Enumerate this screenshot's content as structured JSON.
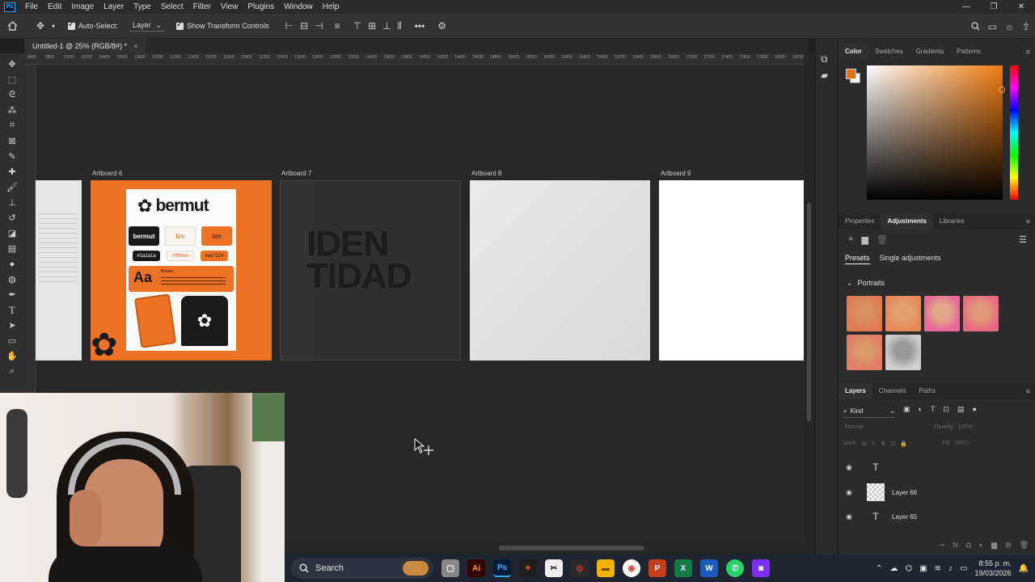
{
  "menubar": {
    "items": [
      "File",
      "Edit",
      "Image",
      "Layer",
      "Type",
      "Select",
      "Filter",
      "View",
      "Plugins",
      "Window",
      "Help"
    ],
    "logo_text": "Ps"
  },
  "options": {
    "auto_select_label": "Auto-Select:",
    "auto_select_value": "Layer",
    "show_transform_label": "Show Transform Controls"
  },
  "document": {
    "tab_title": "Untitled-1 @ 25% (RGB/8#) *",
    "close": "×"
  },
  "ruler": {
    "labels": [
      "8600",
      "8800",
      "10000",
      "10200",
      "10400",
      "10600",
      "10800",
      "11000",
      "11200",
      "11400",
      "11600",
      "11800",
      "12000",
      "12200",
      "12400",
      "12600",
      "12800",
      "13000",
      "13200",
      "13400",
      "13600",
      "13800",
      "14000",
      "14200",
      "14400",
      "14600",
      "14800",
      "15000",
      "15200",
      "15400",
      "15600",
      "15800",
      "16000",
      "16200",
      "16400",
      "16600",
      "16800",
      "17000",
      "17200",
      "17400",
      "17600",
      "17800",
      "18000",
      "18200"
    ]
  },
  "artboards": [
    {
      "label": "Artboard 6"
    },
    {
      "label": "Artboard 7",
      "text_line1": "IDEN",
      "text_line2": "TIDAD"
    },
    {
      "label": "Artboard 8"
    },
    {
      "label": "Artboard 9"
    }
  ],
  "brand": {
    "name": "bermut",
    "short": "bm",
    "hex1": "#1a1a1a",
    "hex2": "#f9f4ee",
    "hex3": "#ee7224",
    "type_sample": "Aa",
    "type_name": "Brewer",
    "colors": {
      "orange": "#ee7224",
      "dark": "#1a1a1a",
      "cream": "#f9f4ee"
    }
  },
  "color_panel": {
    "tabs": [
      "Color",
      "Swatches",
      "Gradients",
      "Patterns"
    ],
    "active_tab": "Color",
    "foreground": "#e07010",
    "background": "#ffffff",
    "hue": "#f07b10"
  },
  "adjust_panel": {
    "tabs": [
      "Properties",
      "Adjustments",
      "Libraries"
    ],
    "active_tab": "Adjustments",
    "subtabs": [
      "Presets",
      "Single adjustments"
    ],
    "group": "Portraits"
  },
  "layers_panel": {
    "tabs": [
      "Layers",
      "Channels",
      "Paths"
    ],
    "active_tab": "Layers",
    "filter": "Kind",
    "blend": "Normal",
    "opacity_label": "Opacity:",
    "opacity": "100%",
    "lock_label": "Lock:",
    "fill_label": "Fill:",
    "fill": "100%",
    "layers": [
      {
        "name": "",
        "type": "text"
      },
      {
        "name": "Layer 66",
        "type": "image"
      },
      {
        "name": "Layer 65",
        "type": "text"
      }
    ]
  },
  "taskbar": {
    "search": "Search",
    "time": "8:55 p. m.",
    "date": "19/03/2026"
  }
}
